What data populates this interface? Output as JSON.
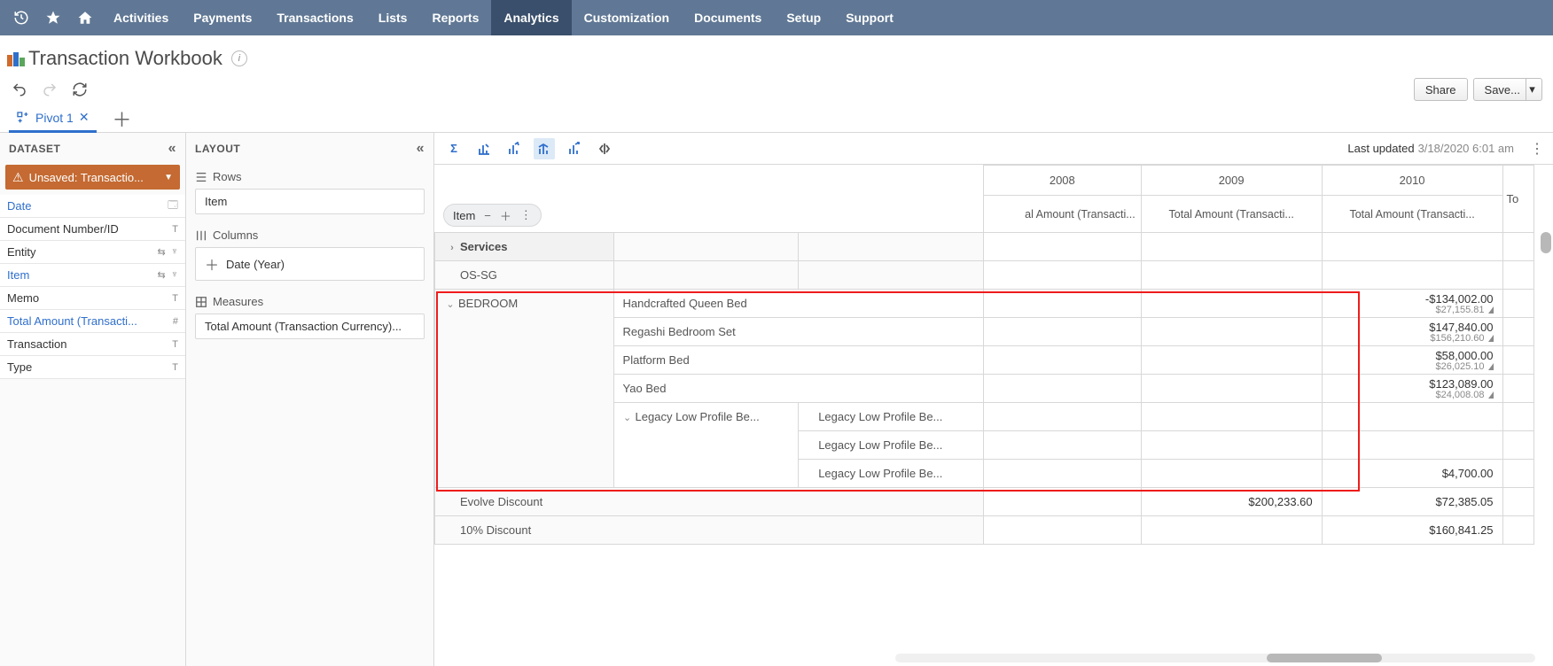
{
  "nav": {
    "icons": [
      "history-icon",
      "star-icon",
      "home-icon"
    ],
    "items": [
      "Activities",
      "Payments",
      "Transactions",
      "Lists",
      "Reports",
      "Analytics",
      "Customization",
      "Documents",
      "Setup",
      "Support"
    ],
    "active": "Analytics"
  },
  "title": "Transaction Workbook",
  "actions": {
    "share": "Share",
    "save": "Save..."
  },
  "tabs": {
    "pivot": "Pivot 1"
  },
  "dataset": {
    "header": "DATASET",
    "selector": "Unsaved: Transactio...",
    "fields": [
      {
        "name": "Date",
        "blue": true,
        "icons": [
          "calendar"
        ]
      },
      {
        "name": "Document Number/ID",
        "blue": false,
        "icons": [
          "text"
        ]
      },
      {
        "name": "Entity",
        "blue": false,
        "icons": [
          "swap",
          "tree"
        ]
      },
      {
        "name": "Item",
        "blue": true,
        "icons": [
          "swap",
          "tree"
        ]
      },
      {
        "name": "Memo",
        "blue": false,
        "icons": [
          "text"
        ]
      },
      {
        "name": "Total Amount (Transacti...",
        "blue": true,
        "icons": [
          "hash"
        ]
      },
      {
        "name": "Transaction",
        "blue": false,
        "icons": [
          "text"
        ]
      },
      {
        "name": "Type",
        "blue": false,
        "icons": [
          "text"
        ]
      }
    ]
  },
  "layout": {
    "header": "LAYOUT",
    "rows": {
      "label": "Rows",
      "chip": "Item"
    },
    "columns": {
      "label": "Columns",
      "chip": "Date  (Year)"
    },
    "measures": {
      "label": "Measures",
      "chip": "Total Amount (Transaction Currency)..."
    }
  },
  "content": {
    "updated_label": "Last updated",
    "updated_ts": "3/18/2020 6:01 am",
    "item_pill": "Item",
    "years": [
      "2008",
      "2009",
      "2010",
      "To"
    ],
    "total_hdr_left": "al Amount (Transacti...",
    "total_hdr": "Total Amount (Transacti...",
    "rows": {
      "services": "Services",
      "ossg": "OS-SG",
      "bedroom": "BEDROOM",
      "bed_items": [
        {
          "name": "Handcrafted Queen Bed",
          "v2010": "-$134,002.00",
          "sub": "$27,155.81"
        },
        {
          "name": "Regashi Bedroom Set",
          "v2010": "$147,840.00",
          "sub": "$156,210.60"
        },
        {
          "name": "Platform Bed",
          "v2010": "$58,000.00",
          "sub": "$26,025.10"
        },
        {
          "name": "Yao Bed",
          "v2010": "$123,089.00",
          "sub": "$24,008.08"
        }
      ],
      "legacy_parent": "Legacy Low Profile Be...",
      "legacy_children": [
        {
          "name": "Legacy Low Profile Be...",
          "v2010": ""
        },
        {
          "name": "Legacy Low Profile Be...",
          "v2010": ""
        },
        {
          "name": "Legacy Low Profile Be...",
          "v2010": "$4,700.00"
        }
      ],
      "evolve": {
        "name": "Evolve Discount",
        "v2009": "$200,233.60",
        "v2010": "$72,385.05"
      },
      "ten": {
        "name": "10% Discount",
        "v2010": "$160,841.25"
      }
    }
  }
}
